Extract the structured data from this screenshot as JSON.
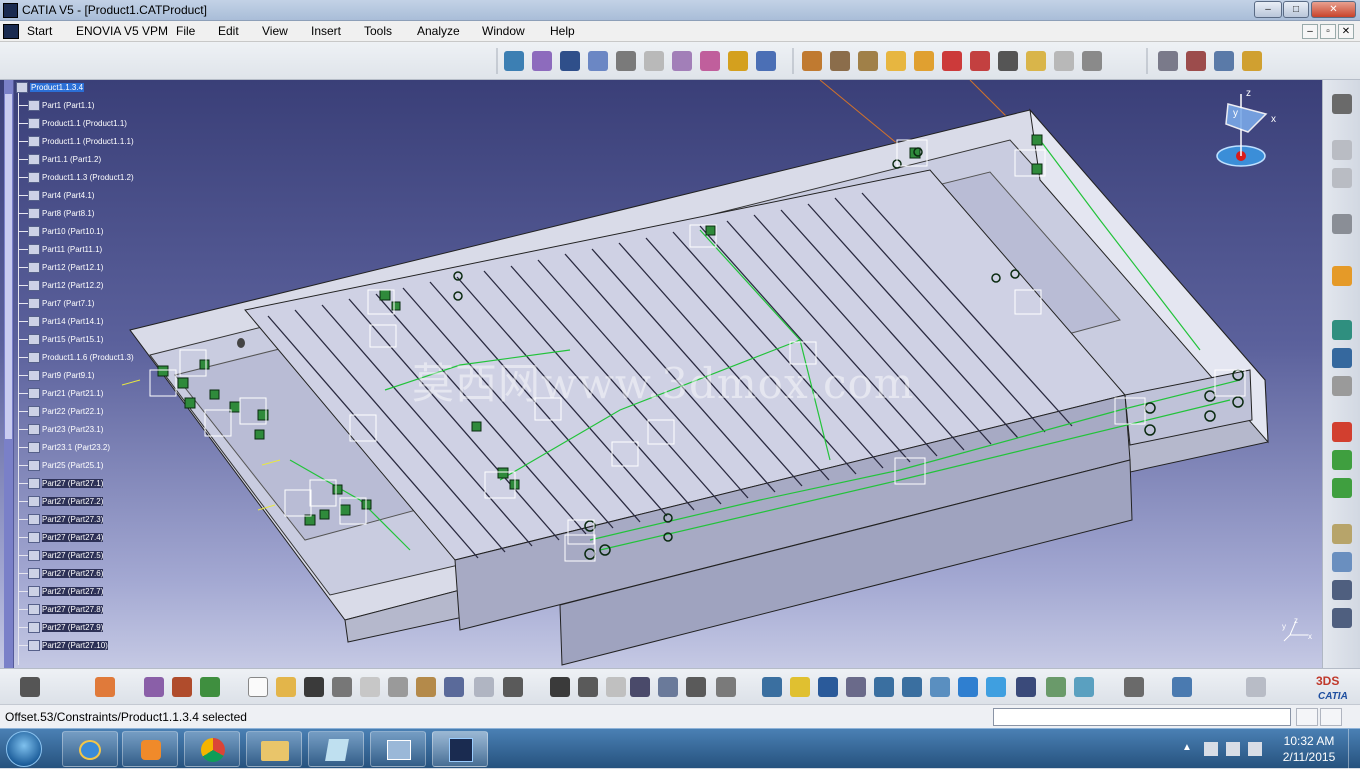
{
  "window": {
    "title": "CATIA V5 - [Product1.CATProduct]",
    "controls": [
      "–",
      "□",
      "✕"
    ]
  },
  "menu": {
    "items": [
      "Start",
      "ENOVIA V5 VPM",
      "File",
      "Edit",
      "View",
      "Insert",
      "Tools",
      "Analyze",
      "Window",
      "Help"
    ],
    "child_controls": [
      "–",
      "▫",
      "✕"
    ]
  },
  "tree": {
    "root": "Product1.1.3.4",
    "items": [
      "Part1 (Part1.1)",
      "Product1.1 (Product1.1)",
      "Product1.1 (Product1.1.1)",
      "Part1.1 (Part1.2)",
      "Product1.1.3 (Product1.2)",
      "Part4 (Part4.1)",
      "Part8 (Part8.1)",
      "Part10 (Part10.1)",
      "Part11 (Part11.1)",
      "Part12 (Part12.1)",
      "Part12 (Part12.2)",
      "Part7 (Part7.1)",
      "Part14 (Part14.1)",
      "Part15 (Part15.1)",
      "Product1.1.6 (Product1.3)",
      "Part9 (Part9.1)",
      "Part21 (Part21.1)",
      "Part22 (Part22.1)",
      "Part23 (Part23.1)",
      "Part23.1 (Part23.2)",
      "Part25 (Part25.1)",
      "Part27 (Part27.1)",
      "Part27 (Part27.2)",
      "Part27 (Part27.3)",
      "Part27 (Part27.4)",
      "Part27 (Part27.5)",
      "Part27 (Part27.6)",
      "Part27 (Part27.7)",
      "Part27 (Part27.8)",
      "Part27 (Part27.9)",
      "Part27 (Part27.10)"
    ]
  },
  "viewport": {
    "watermark": "莫西网www.3dmox.com",
    "compass_axes": [
      "z",
      "y",
      "x"
    ],
    "mini_axes": [
      "y",
      "z",
      "x"
    ],
    "background_top": "#3a3f78",
    "background_bottom": "#c5c9e4"
  },
  "status": {
    "text": "Offset.53/Constraints/Product1.1.3.4 selected",
    "command_value": ""
  },
  "taskbar": {
    "time": "10:32 AM",
    "date": "2/11/2015"
  },
  "icons": {
    "top": [
      "constraint-icon",
      "fix-icon",
      "coincidence-icon",
      "contact-icon",
      "offset-icon",
      "angle-icon",
      "fix-together-icon",
      "quick-constraint-icon",
      "flexible-icon",
      "change-constraint-icon",
      "reuse-pattern-icon",
      "manipulate-icon",
      "snap-icon",
      "explode-icon",
      "stop-manipulate-icon",
      "clash-icon",
      "section-icon",
      "distance-icon",
      "annotation-icon",
      "text-icon",
      "flag-icon",
      "sketch-icon",
      "catalog-icon",
      "update-icon",
      "scenes-icon",
      "pattern-icon"
    ],
    "bottom": [
      "camera-icon",
      "grid-icon",
      "workbench-icon",
      "tools-icon",
      "sample-icon",
      "new-icon",
      "open-icon",
      "save-icon",
      "print-icon",
      "cut-icon",
      "copy-icon",
      "paste-icon",
      "undo-icon",
      "redo-icon",
      "help-icon",
      "formula-icon",
      "comment-icon",
      "knowledge-icon",
      "table-icon",
      "compass-icon",
      "measure-icon",
      "ruler-icon",
      "fly-icon",
      "fit-all-icon",
      "pan-icon",
      "rotate-icon",
      "zoom-in-icon",
      "zoom-out-icon",
      "normal-view-icon",
      "iso-view-icon",
      "shading-icon",
      "render-icon",
      "hide-show-icon",
      "swap-icon",
      "save-view-icon",
      "catalog-browser-icon",
      "refresh-icon"
    ]
  }
}
